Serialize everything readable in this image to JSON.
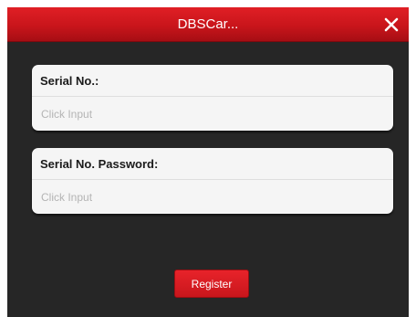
{
  "dialog": {
    "title": "DBSCar...",
    "close_icon": "close-icon"
  },
  "form": {
    "serial": {
      "label": "Serial No.:",
      "placeholder": "Click Input",
      "value": ""
    },
    "password": {
      "label": "Serial No. Password:",
      "placeholder": "Click Input",
      "value": ""
    },
    "register_label": "Register"
  },
  "colors": {
    "accent": "#c8161c",
    "background": "#262626",
    "card": "#f5f5f5"
  }
}
